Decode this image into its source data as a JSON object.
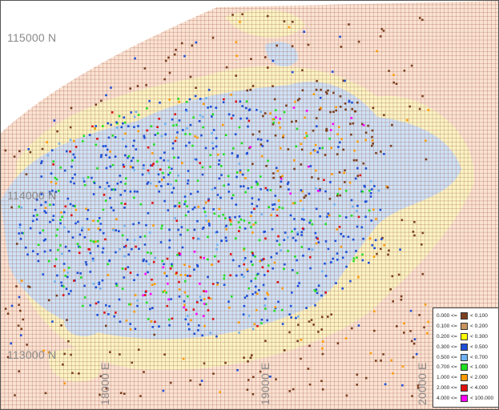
{
  "map": {
    "northings": [
      {
        "label": "115000 N"
      },
      {
        "label": "114000 N"
      },
      {
        "label": "113000 N"
      }
    ],
    "eastings": [
      {
        "label": "18000 E"
      },
      {
        "label": "19000 E"
      },
      {
        "label": "20000 E"
      }
    ],
    "grid_line_color": "#8b3a2a",
    "background_colors": {
      "outer": "#fbe3d3",
      "mid": "#fbf4c4",
      "inner": "#cfe2f6"
    }
  },
  "legend": {
    "items": [
      {
        "low": "0.000 <=",
        "high": "< 0.100",
        "color": "#7b3f1f"
      },
      {
        "low": "0.100 <=",
        "high": "< 0.200",
        "color": "#c8935f"
      },
      {
        "low": "0.200 <=",
        "high": "< 0.300",
        "color": "#ffff00"
      },
      {
        "low": "0.300 <=",
        "high": "< 0.500",
        "color": "#1f4fd8"
      },
      {
        "low": "0.500 <=",
        "high": "< 0.700",
        "color": "#6fb2f2"
      },
      {
        "low": "0.700 <=",
        "high": "< 1.000",
        "color": "#22e022"
      },
      {
        "low": "1.000 <=",
        "high": "< 2.000",
        "color": "#ff9a00"
      },
      {
        "low": "2.000 <=",
        "high": "< 4.000",
        "color": "#e01010"
      },
      {
        "low": "4.000 <=",
        "high": "< 100.000",
        "color": "#ff00ff"
      }
    ]
  }
}
